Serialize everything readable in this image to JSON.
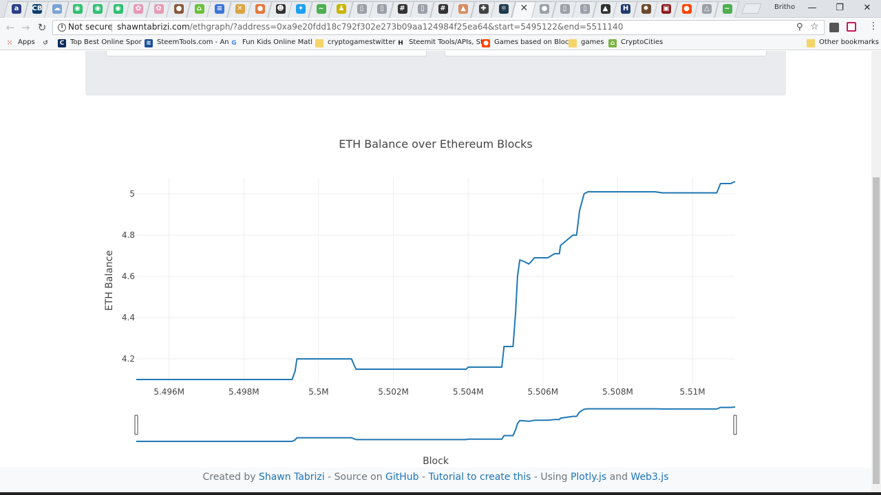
{
  "browser": {
    "profile_name": "Britho",
    "security_label": "Not secure",
    "url_host": "shawntabrizi.com",
    "url_path": "/ethgraph/?address=0xa9e20fdd18c792f302e273b09aa124984f25ea64&start=5495122&end=5511140",
    "tab_close_glyph": "✕",
    "window_controls": {
      "minimize": "—",
      "restore": "❐",
      "close": "✕"
    },
    "tab_favicons": [
      {
        "name": "tab-blue-a",
        "color": "#2a3f8c",
        "glyph": "a"
      },
      {
        "name": "tab-cbs",
        "color": "#0d3e6e",
        "glyph": "CB"
      },
      {
        "name": "tab-blue-cloud",
        "color": "#7aa3d6",
        "glyph": "☁"
      },
      {
        "name": "tab-green-1",
        "color": "#2fbf71",
        "glyph": "◉"
      },
      {
        "name": "tab-green-2",
        "color": "#2fbf71",
        "glyph": "◉"
      },
      {
        "name": "tab-green-3",
        "color": "#2fbf71",
        "glyph": "◉"
      },
      {
        "name": "tab-pink-1",
        "color": "#e89ab4",
        "glyph": "✿"
      },
      {
        "name": "tab-pink-2",
        "color": "#e89ab4",
        "glyph": "✿"
      },
      {
        "name": "tab-brown",
        "color": "#8a5a3b",
        "glyph": "●"
      },
      {
        "name": "tab-green-home",
        "color": "#6cbf3a",
        "glyph": "⌂"
      },
      {
        "name": "tab-docs",
        "color": "#3b73d9",
        "glyph": "≡"
      },
      {
        "name": "tab-cross",
        "color": "#d9a441",
        "glyph": "✕"
      },
      {
        "name": "tab-orange",
        "color": "#e8743b",
        "glyph": "●"
      },
      {
        "name": "tab-dark-face",
        "color": "#333333",
        "glyph": "☻"
      },
      {
        "name": "tab-twitter",
        "color": "#1da1f2",
        "glyph": "✦"
      },
      {
        "name": "tab-green-leaf",
        "color": "#4caf50",
        "glyph": "~"
      },
      {
        "name": "tab-yellow-man",
        "color": "#c8b400",
        "glyph": "♟"
      },
      {
        "name": "tab-page-1",
        "color": "#9aa0a6",
        "glyph": "▯"
      },
      {
        "name": "tab-page-2",
        "color": "#9aa0a6",
        "glyph": "▯"
      },
      {
        "name": "tab-hash-1",
        "color": "#333333",
        "glyph": "#"
      },
      {
        "name": "tab-page-3",
        "color": "#9aa0a6",
        "glyph": "▯"
      },
      {
        "name": "tab-hash-2",
        "color": "#333333",
        "glyph": "#"
      },
      {
        "name": "tab-tree",
        "color": "#d98c5f",
        "glyph": "▲"
      },
      {
        "name": "tab-puzzle",
        "color": "#444444",
        "glyph": "✚"
      },
      {
        "name": "tab-react",
        "color": "#1f3a4d",
        "glyph": "⚛"
      },
      {
        "name": "tab-active",
        "color": "#ffffff",
        "glyph": ""
      },
      {
        "name": "tab-gray-ball",
        "color": "#9aa0a6",
        "glyph": "●"
      },
      {
        "name": "tab-page-4",
        "color": "#9aa0a6",
        "glyph": "▯"
      },
      {
        "name": "tab-page-5",
        "color": "#9aa0a6",
        "glyph": "▯"
      },
      {
        "name": "tab-hat",
        "color": "#333333",
        "glyph": "▲"
      },
      {
        "name": "tab-h-blue",
        "color": "#1f3a6e",
        "glyph": "H"
      },
      {
        "name": "tab-gear",
        "color": "#6b4a2e",
        "glyph": "✹"
      },
      {
        "name": "tab-red-dark",
        "color": "#8b1a1a",
        "glyph": "▣"
      },
      {
        "name": "tab-reddit",
        "color": "#ff4500",
        "glyph": "●"
      },
      {
        "name": "tab-triangle",
        "color": "#9aa0a6",
        "glyph": "△"
      },
      {
        "name": "tab-green-bird",
        "color": "#4caf50",
        "glyph": "~"
      }
    ],
    "bookmarks": [
      {
        "name": "bookmark-apps",
        "label": "Apps",
        "icon": "apps-grid-icon",
        "color": "#e94235"
      },
      {
        "name": "bookmark-history",
        "label": "",
        "icon": "history-icon",
        "color": "#555555"
      },
      {
        "name": "bookmark-sports",
        "label": "Top Best Online Spor",
        "icon": "c-logo-icon",
        "color": "#0a2a5e"
      },
      {
        "name": "bookmark-steemtools",
        "label": "SteemTools.com - An",
        "icon": "steem-icon",
        "color": "#1a5099"
      },
      {
        "name": "bookmark-fun-kids",
        "label": "Fun Kids Online Matl",
        "icon": "google-icon",
        "color": "#4285f4"
      },
      {
        "name": "bookmark-cryptogamestwitter",
        "label": "cryptogamestwitter",
        "icon": "folder-icon",
        "color": "#f5d46a"
      },
      {
        "name": "bookmark-steemit-tools",
        "label": "Steemit Tools/APIs, St",
        "icon": "h-icon",
        "color": "#222222"
      },
      {
        "name": "bookmark-games-block",
        "label": "Games based on Bloc",
        "icon": "reddit-icon",
        "color": "#ff4500"
      },
      {
        "name": "bookmark-games",
        "label": "games",
        "icon": "folder-icon",
        "color": "#f5d46a"
      },
      {
        "name": "bookmark-cryptocities",
        "label": "CryptoCities",
        "icon": "cryptocities-icon",
        "color": "#7cb342"
      },
      {
        "name": "bookmark-other",
        "label": "Other bookmarks",
        "icon": "folder-icon",
        "color": "#f5d46a"
      }
    ]
  },
  "footer": {
    "prefix": "Created by ",
    "author": "Shawn Tabrizi",
    "source_text": " - Source on ",
    "github": "GitHub",
    "dash": " - ",
    "tutorial": "Tutorial to create this",
    "using_text": " - Using ",
    "plotly": "Plotly.js",
    "and_text": " and ",
    "web3": "Web3.js"
  },
  "chart_data": {
    "type": "line",
    "title": "ETH Balance over Ethereum Blocks",
    "xlabel": "Block",
    "ylabel": "ETH Balance",
    "xlim": [
      5495122,
      5511140
    ],
    "ylim": [
      4.08,
      5.08
    ],
    "xticks": [
      {
        "value": 5496000,
        "label": "5.496M"
      },
      {
        "value": 5498000,
        "label": "5.498M"
      },
      {
        "value": 5500000,
        "label": "5.5M"
      },
      {
        "value": 5502000,
        "label": "5.502M"
      },
      {
        "value": 5504000,
        "label": "5.504M"
      },
      {
        "value": 5506000,
        "label": "5.506M"
      },
      {
        "value": 5508000,
        "label": "5.508M"
      },
      {
        "value": 5510000,
        "label": "5.51M"
      }
    ],
    "yticks": [
      {
        "value": 4.2,
        "label": "4.2"
      },
      {
        "value": 4.4,
        "label": "4.4"
      },
      {
        "value": 4.6,
        "label": "4.6"
      },
      {
        "value": 4.8,
        "label": "4.8"
      },
      {
        "value": 5.0,
        "label": "5"
      }
    ],
    "grid": true,
    "line_color": "#1f77b4",
    "has_range_slider": true,
    "series": [
      {
        "x": [
          5495122,
          5499290,
          5499370,
          5499420,
          5500880,
          5500950,
          5501000,
          5503950,
          5504000,
          5504900,
          5504960,
          5505200,
          5505270,
          5505320,
          5505380,
          5505520,
          5505620,
          5505680,
          5505770,
          5506100,
          5506130,
          5506310,
          5506440,
          5506470,
          5506800,
          5506850,
          5506900,
          5506980,
          5507100,
          5507200,
          5509000,
          5509200,
          5510650,
          5510750,
          5510960,
          5511020,
          5511140
        ],
        "y": [
          4.1,
          4.1,
          4.14,
          4.2,
          4.2,
          4.17,
          4.15,
          4.15,
          4.16,
          4.16,
          4.26,
          4.26,
          4.43,
          4.6,
          4.68,
          4.67,
          4.66,
          4.67,
          4.69,
          4.69,
          4.69,
          4.71,
          4.71,
          4.75,
          4.8,
          4.8,
          4.8,
          4.92,
          5.0,
          5.01,
          5.01,
          5.005,
          5.005,
          5.05,
          5.05,
          5.05,
          5.06
        ]
      }
    ]
  }
}
